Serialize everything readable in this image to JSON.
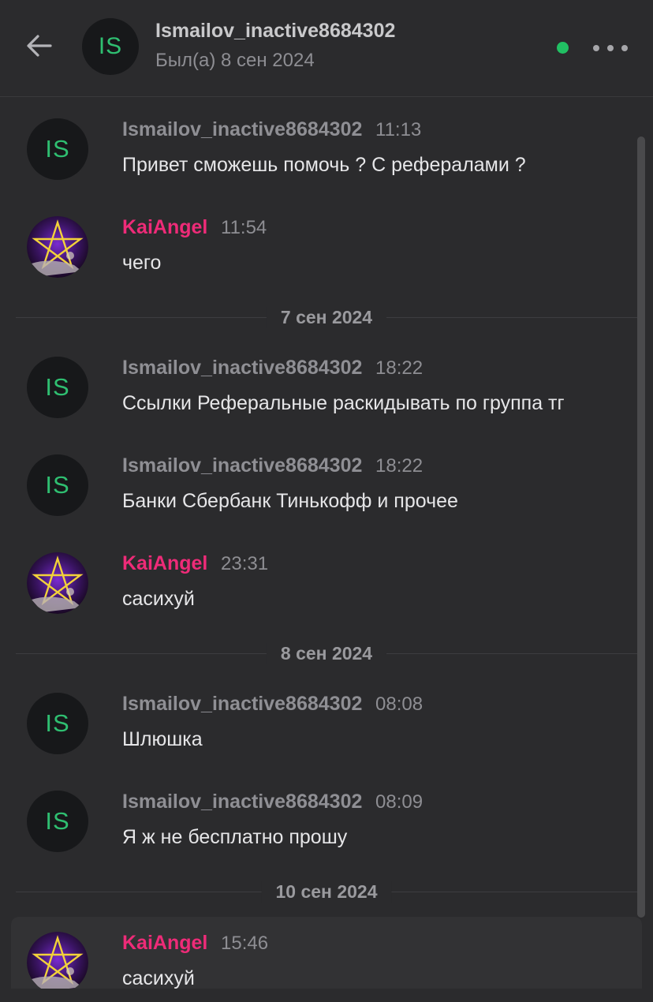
{
  "header": {
    "title": "Ismailov_inactive8684302",
    "status": "Был(а) 8 сен 2024",
    "avatar_initials": "IS",
    "back_icon": "arrow-left-icon",
    "more_icon": "more-horizontal-icon",
    "online_color": "#21c063"
  },
  "messages": [
    {
      "author": "Ismailov_inactive8684302",
      "time": "11:13",
      "text": "Привет сможешь помочь ? С рефералами ?",
      "avatar": "IS"
    },
    {
      "author": "KaiAngel",
      "time": "11:54",
      "text": "чего",
      "avatar": "pentagram-image"
    },
    {
      "author": "Ismailov_inactive8684302",
      "time": "18:22",
      "text": "Ссылки Реферальные раскидывать по группа тг",
      "avatar": "IS"
    },
    {
      "author": "Ismailov_inactive8684302",
      "time": "18:22",
      "text": "Банки Сбербанк Тинькофф и прочее",
      "avatar": "IS"
    },
    {
      "author": "KaiAngel",
      "time": "23:31",
      "text": "сасихуй",
      "avatar": "pentagram-image"
    },
    {
      "author": "Ismailov_inactive8684302",
      "time": "08:08",
      "text": "Шлюшка",
      "avatar": "IS"
    },
    {
      "author": "Ismailov_inactive8684302",
      "time": "08:09",
      "text": "Я ж не бесплатно прошу",
      "avatar": "IS"
    },
    {
      "author": "KaiAngel",
      "time": "15:46",
      "text": "сасихуй",
      "avatar": "pentagram-image"
    }
  ],
  "date_dividers": [
    "7 сен 2024",
    "8 сен 2024",
    "10 сен 2024"
  ],
  "colors": {
    "accent_pink": "#ee2b78",
    "initials_green": "#2fbf71",
    "background": "#2b2b2d"
  }
}
